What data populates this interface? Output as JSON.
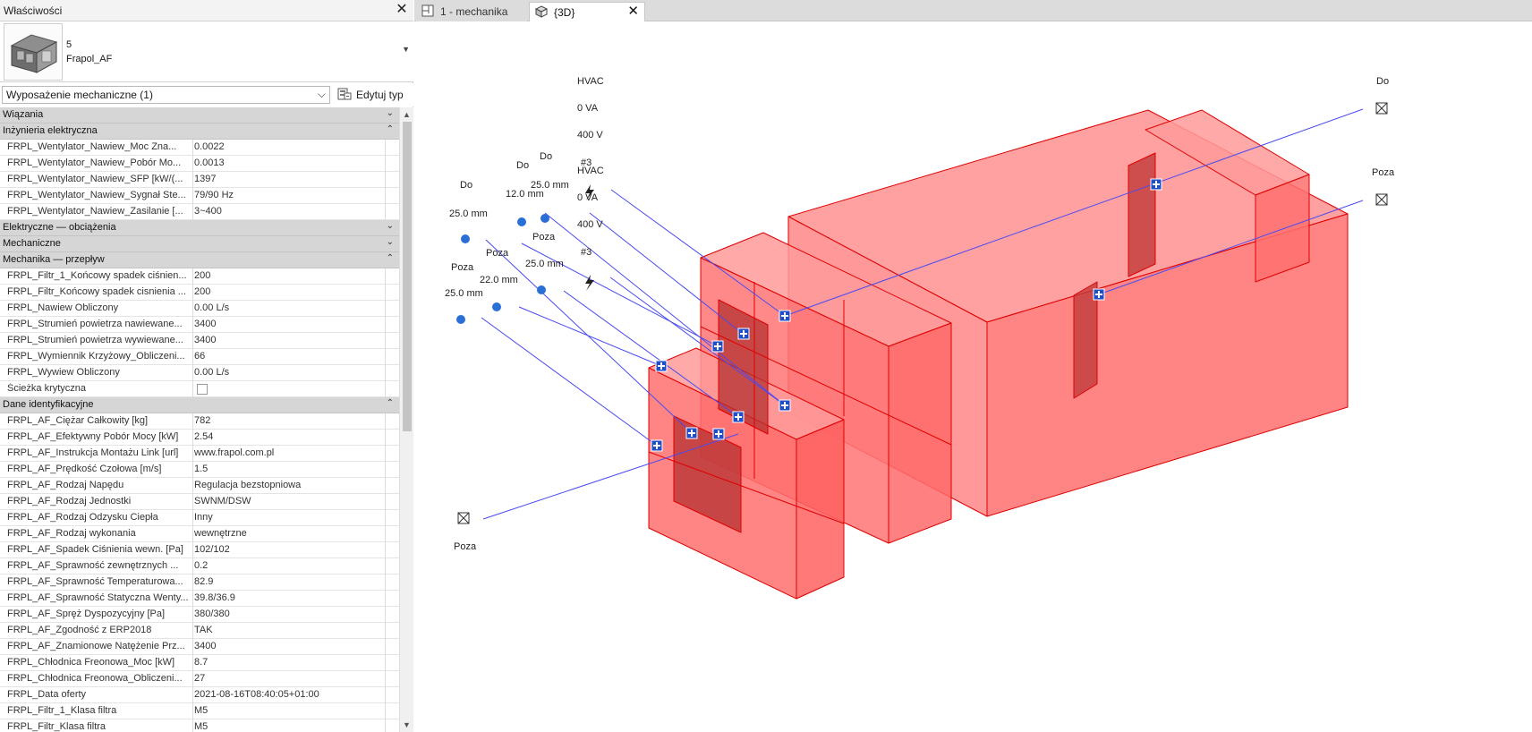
{
  "properties": {
    "title": "Właściwości",
    "type_number": "5",
    "type_name": "Frapol_AF",
    "category_filter": "Wyposażenie mechaniczne (1)",
    "edit_type_label": "Edytuj typ"
  },
  "groups": [
    {
      "name": "Wiązania",
      "toggle": "⌄",
      "rows": []
    },
    {
      "name": "Inżynieria elektryczna",
      "toggle": "⌃",
      "rows": [
        {
          "name": "FRPL_Wentylator_Nawiew_Moc Zna...",
          "value": "0.0022"
        },
        {
          "name": "FRPL_Wentylator_Nawiew_Pobór Mo...",
          "value": "0.0013"
        },
        {
          "name": "FRPL_Wentylator_Nawiew_SFP [kW/(...",
          "value": "1397"
        },
        {
          "name": "FRPL_Wentylator_Nawiew_Sygnał Ste...",
          "value": "79/90 Hz"
        },
        {
          "name": "FRPL_Wentylator_Nawiew_Zasilanie [...",
          "value": "3~400"
        }
      ]
    },
    {
      "name": "Elektryczne — obciążenia",
      "toggle": "⌄",
      "rows": []
    },
    {
      "name": "Mechaniczne",
      "toggle": "⌄",
      "rows": []
    },
    {
      "name": "Mechanika — przepływ",
      "toggle": "⌃",
      "rows": [
        {
          "name": "FRPL_Filtr_1_Końcowy spadek ciśnien...",
          "value": "200"
        },
        {
          "name": "FRPL_Filtr_Końcowy spadek cisnienia ...",
          "value": "200"
        },
        {
          "name": "FRPL_Nawiew Obliczony",
          "value": "0.00 L/s"
        },
        {
          "name": "FRPL_Strumień powietrza nawiewane...",
          "value": "3400"
        },
        {
          "name": "FRPL_Strumień powietrza wywiewane...",
          "value": "3400"
        },
        {
          "name": "FRPL_Wymiennik Krzyżowy_Obliczeni...",
          "value": "66"
        },
        {
          "name": "FRPL_Wywiew Obliczony",
          "value": "0.00 L/s"
        },
        {
          "name": "Ścieżka krytyczna",
          "value": "",
          "checkbox": true
        }
      ]
    },
    {
      "name": "Dane identyfikacyjne",
      "toggle": "⌃",
      "rows": [
        {
          "name": "FRPL_AF_Ciężar Całkowity [kg]",
          "value": "782"
        },
        {
          "name": "FRPL_AF_Efektywny Pobór  Mocy [kW]",
          "value": "2.54"
        },
        {
          "name": "FRPL_AF_Instrukcja Montażu Link [url]",
          "value": "www.frapol.com.pl"
        },
        {
          "name": "FRPL_AF_Prędkość  Czołowa [m/s]",
          "value": "1.5"
        },
        {
          "name": "FRPL_AF_Rodzaj  Napędu",
          "value": "Regulacja bezstopniowa"
        },
        {
          "name": "FRPL_AF_Rodzaj Jednostki",
          "value": "SWNM/DSW"
        },
        {
          "name": "FRPL_AF_Rodzaj Odzysku Ciepła",
          "value": "Inny"
        },
        {
          "name": "FRPL_AF_Rodzaj wykonania",
          "value": "wewnętrzne"
        },
        {
          "name": "FRPL_AF_Spadek Ciśnienia  wewn. [Pa]",
          "value": "102/102"
        },
        {
          "name": "FRPL_AF_Sprawność   zewnętrznych ...",
          "value": "0.2"
        },
        {
          "name": "FRPL_AF_Sprawność  Temperaturowa...",
          "value": "82.9"
        },
        {
          "name": "FRPL_AF_Sprawność Statyczna Wenty...",
          "value": "39.8/36.9"
        },
        {
          "name": "FRPL_AF_Spręż Dyspozycyjny [Pa]",
          "value": "380/380"
        },
        {
          "name": "FRPL_AF_Zgodność z ERP2018",
          "value": "TAK"
        },
        {
          "name": "FRPL_AF_Znamionowe Natężenie  Prz...",
          "value": "3400"
        },
        {
          "name": "FRPL_Chłodnica  Freonowa_Moc [kW]",
          "value": "8.7"
        },
        {
          "name": "FRPL_Chłodnica  Freonowa_Obliczeni...",
          "value": "27"
        },
        {
          "name": "FRPL_Data oferty",
          "value": "2021-08-16T08:40:05+01:00"
        },
        {
          "name": "FRPL_Filtr_1_Klasa filtra",
          "value": "M5"
        },
        {
          "name": "FRPL_Filtr_Klasa filtra",
          "value": "M5"
        }
      ]
    }
  ],
  "tabs": [
    {
      "label": "1 - mechanika",
      "icon": "floor-plan-icon"
    },
    {
      "label": "{3D}",
      "icon": "3d-view-icon"
    }
  ],
  "view_labels": {
    "hvac1": "HVAC",
    "va1": "0 VA",
    "v400_1": "400 V",
    "n3_1": "#3",
    "hvac2": "HVAC",
    "va2": "0 VA",
    "v400_2": "400 V",
    "n3_2": "#3",
    "do_a": "Do",
    "do_b": "Do",
    "do_c": "Do",
    "do_right": "Do",
    "mm12": "12.0 mm",
    "mm25a": "25.0 mm",
    "mm25b": "25.0 mm",
    "mm25c": "25.0 mm",
    "mm25d": "25.0 mm",
    "mm22": "22.0 mm",
    "poza_a": "Poza",
    "poza_b": "Poza",
    "poza_c": "Poza",
    "poza_right": "Poza",
    "poza_bottom": "Poza"
  },
  "colors": {
    "box_fill": "#ff6b6b",
    "box_edge": "#e00000",
    "leader": "#4a4af0",
    "connector": "#1f4fc8"
  }
}
